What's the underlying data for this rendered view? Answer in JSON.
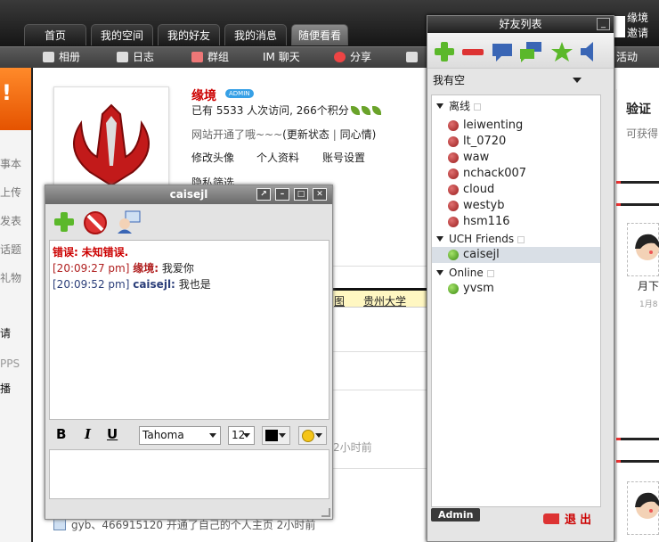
{
  "nav": {
    "tabs": [
      {
        "label": "首页"
      },
      {
        "label": "我的空间"
      },
      {
        "label": "我的好友"
      },
      {
        "label": "我的消息"
      },
      {
        "label": "随便看看",
        "active": true
      }
    ],
    "subnav": [
      "相册",
      "日志",
      "群组",
      "IM 聊天",
      "分享",
      "活动"
    ],
    "user_name": "缘境",
    "invite": "邀请"
  },
  "left": {
    "banner_text": "!",
    "links": [
      "事本",
      "上传",
      "发表",
      "话题",
      "礼物",
      "PPS",
      "播"
    ],
    "partial_char": "请"
  },
  "profile": {
    "name": "缘境",
    "badge": "ADMIN",
    "visits": "已有  5533 人次访问, 266个积分",
    "status": "网站开通了哦~~~",
    "update_status": "(更新状态",
    "sep": "|",
    "same_heart": "同心情)",
    "links": [
      "修改头像",
      "个人资料",
      "账号设置"
    ],
    "privacy": "隐私筛选"
  },
  "feed": {
    "tags": [
      "图",
      "贵州大学"
    ],
    "time": "2小时前",
    "bottom": "gyb、466915120 开通了自己的个人主页  2小时前"
  },
  "rightcol": {
    "verify_title": "验证",
    "verify_sub": "可获得",
    "month": "月下",
    "date": "1月8"
  },
  "friendlist": {
    "title": "好友列表",
    "close": "_",
    "status": "我有空",
    "groups": [
      {
        "name": "离线",
        "contacts": [
          "leiwenting",
          "lt_0720",
          "waw",
          "nchack007",
          "cloud",
          "westyb",
          "hsm116"
        ],
        "online": false
      },
      {
        "name": "UCH Friends",
        "contacts": [
          "caisejl"
        ],
        "online": true
      },
      {
        "name": "Online",
        "contacts": [
          "yvsm"
        ],
        "online": true
      }
    ],
    "admin": "Admin",
    "exit": "退出",
    "colors": {
      "accent_red": "#cc0000",
      "online_green": "#3b8a12",
      "offline_red": "#9a1e1e"
    }
  },
  "chat": {
    "title": "caisejl",
    "buttons": [
      "popout",
      "minimize",
      "maximize",
      "close"
    ],
    "messages": [
      {
        "type": "error",
        "label": "错误:",
        "text": "未知错误."
      },
      {
        "time": "[20:09:27 pm]",
        "name": "缘境:",
        "text": "我爱你"
      },
      {
        "time": "[20:09:52 pm]",
        "name": "caisejl:",
        "text": "我也是"
      }
    ],
    "format": {
      "bold": "B",
      "italic": "I",
      "underline": "U",
      "font": "Tahoma",
      "size": "12",
      "color": "#000000"
    }
  }
}
